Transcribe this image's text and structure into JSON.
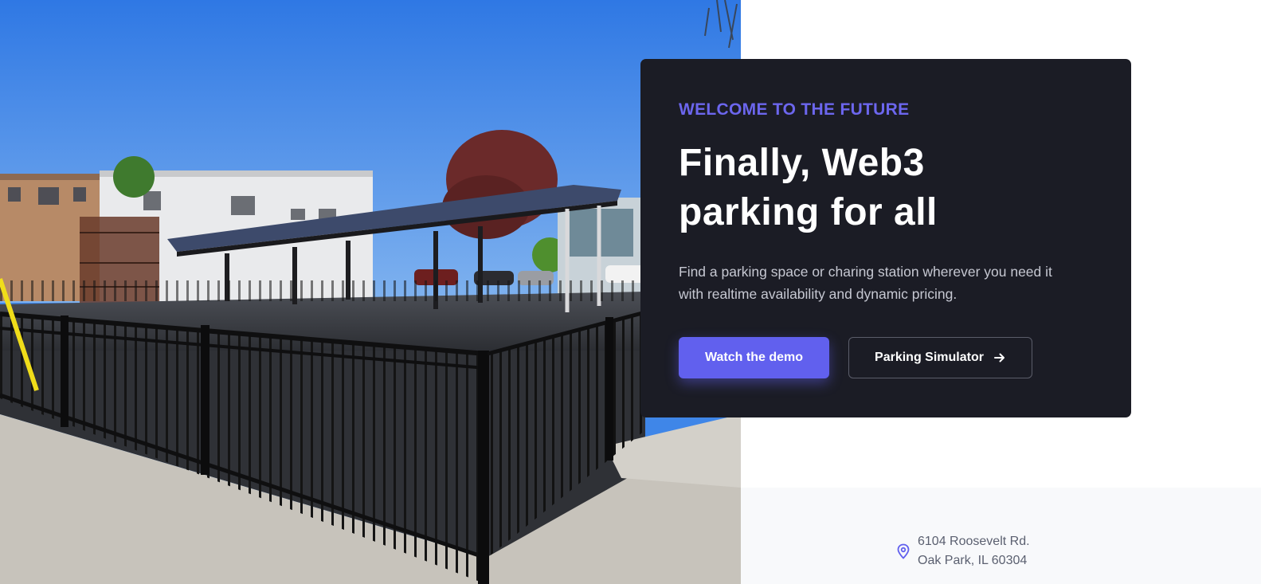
{
  "hero": {
    "eyebrow": "WELCOME TO THE FUTURE",
    "headline_line1": "Finally, Web3",
    "headline_line2": "parking for all",
    "subtext": "Find a parking space or charing station wherever you need it with realtime availability and dynamic pricing.",
    "primary_button_label": "Watch the demo",
    "secondary_button_label": "Parking Simulator",
    "secondary_button_icon": "arrow-right-icon"
  },
  "address": {
    "icon": "map-pin-icon",
    "line1": "6104 Roosevelt Rd.",
    "line2": "Oak Park, IL 60304"
  },
  "colors": {
    "accent": "#6160ee",
    "eyebrow": "#6c66ee",
    "card_background": "#1b1c25",
    "strip_background": "#f8f9fb"
  }
}
